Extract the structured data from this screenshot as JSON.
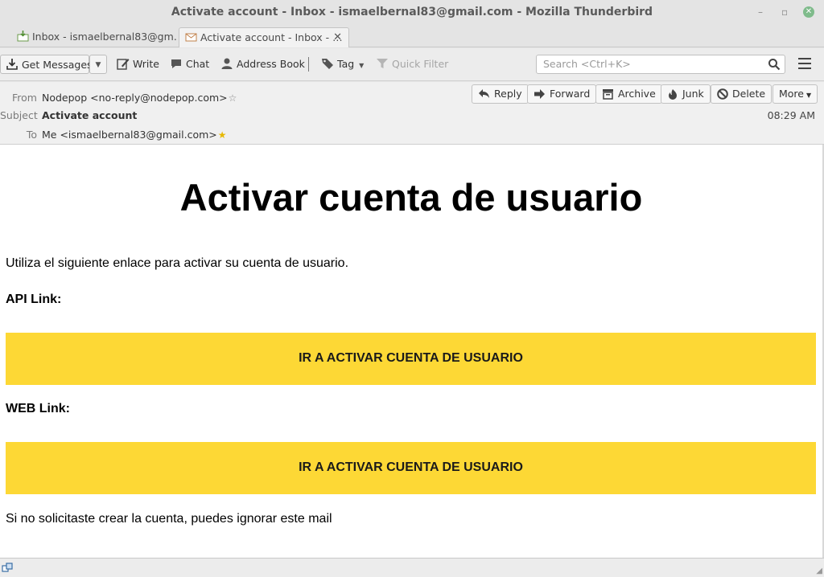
{
  "window": {
    "title": "Activate account - Inbox - ismaelbernal83@gmail.com - Mozilla Thunderbird",
    "controls": {
      "minimize": "–",
      "restore": "▫",
      "close": "✕"
    }
  },
  "tabs": [
    {
      "label": "Inbox - ismaelbernal83@gm…",
      "icon": "inbox-icon"
    },
    {
      "label": "Activate account - Inbox - …",
      "icon": "envelope-icon",
      "close": "✕"
    }
  ],
  "toolbar": {
    "get_messages": "Get Messages",
    "write": "Write",
    "chat": "Chat",
    "address_book": "Address Book",
    "tag": "Tag",
    "quick_filter": "Quick Filter",
    "search_placeholder": "Search <Ctrl+K>"
  },
  "header": {
    "from_label": "From",
    "from_value": "Nodepop <no-reply@nodepop.com>",
    "subject_label": "Subject",
    "subject_value": "Activate account",
    "to_label": "To",
    "to_value": "Me <ismaelbernal83@gmail.com>",
    "time": "08:29 AM",
    "buttons": {
      "reply": "Reply",
      "forward": "Forward",
      "archive": "Archive",
      "junk": "Junk",
      "delete": "Delete",
      "more": "More"
    }
  },
  "message": {
    "heading": "Activar cuenta de usuario",
    "intro": "Utiliza el siguiente enlace para activar su cuenta de usuario.",
    "api_label": "API Link:",
    "api_button": "IR A ACTIVAR CUENTA DE USUARIO",
    "web_label": "WEB Link:",
    "web_button": "IR A ACTIVAR CUENTA DE USUARIO",
    "footer": "Si no solicitaste crear la cuenta, puedes ignorar este mail"
  },
  "colors": {
    "cta_background": "#fdd835",
    "close_button": "#7fbb8b",
    "star_filled": "#e6b800"
  }
}
